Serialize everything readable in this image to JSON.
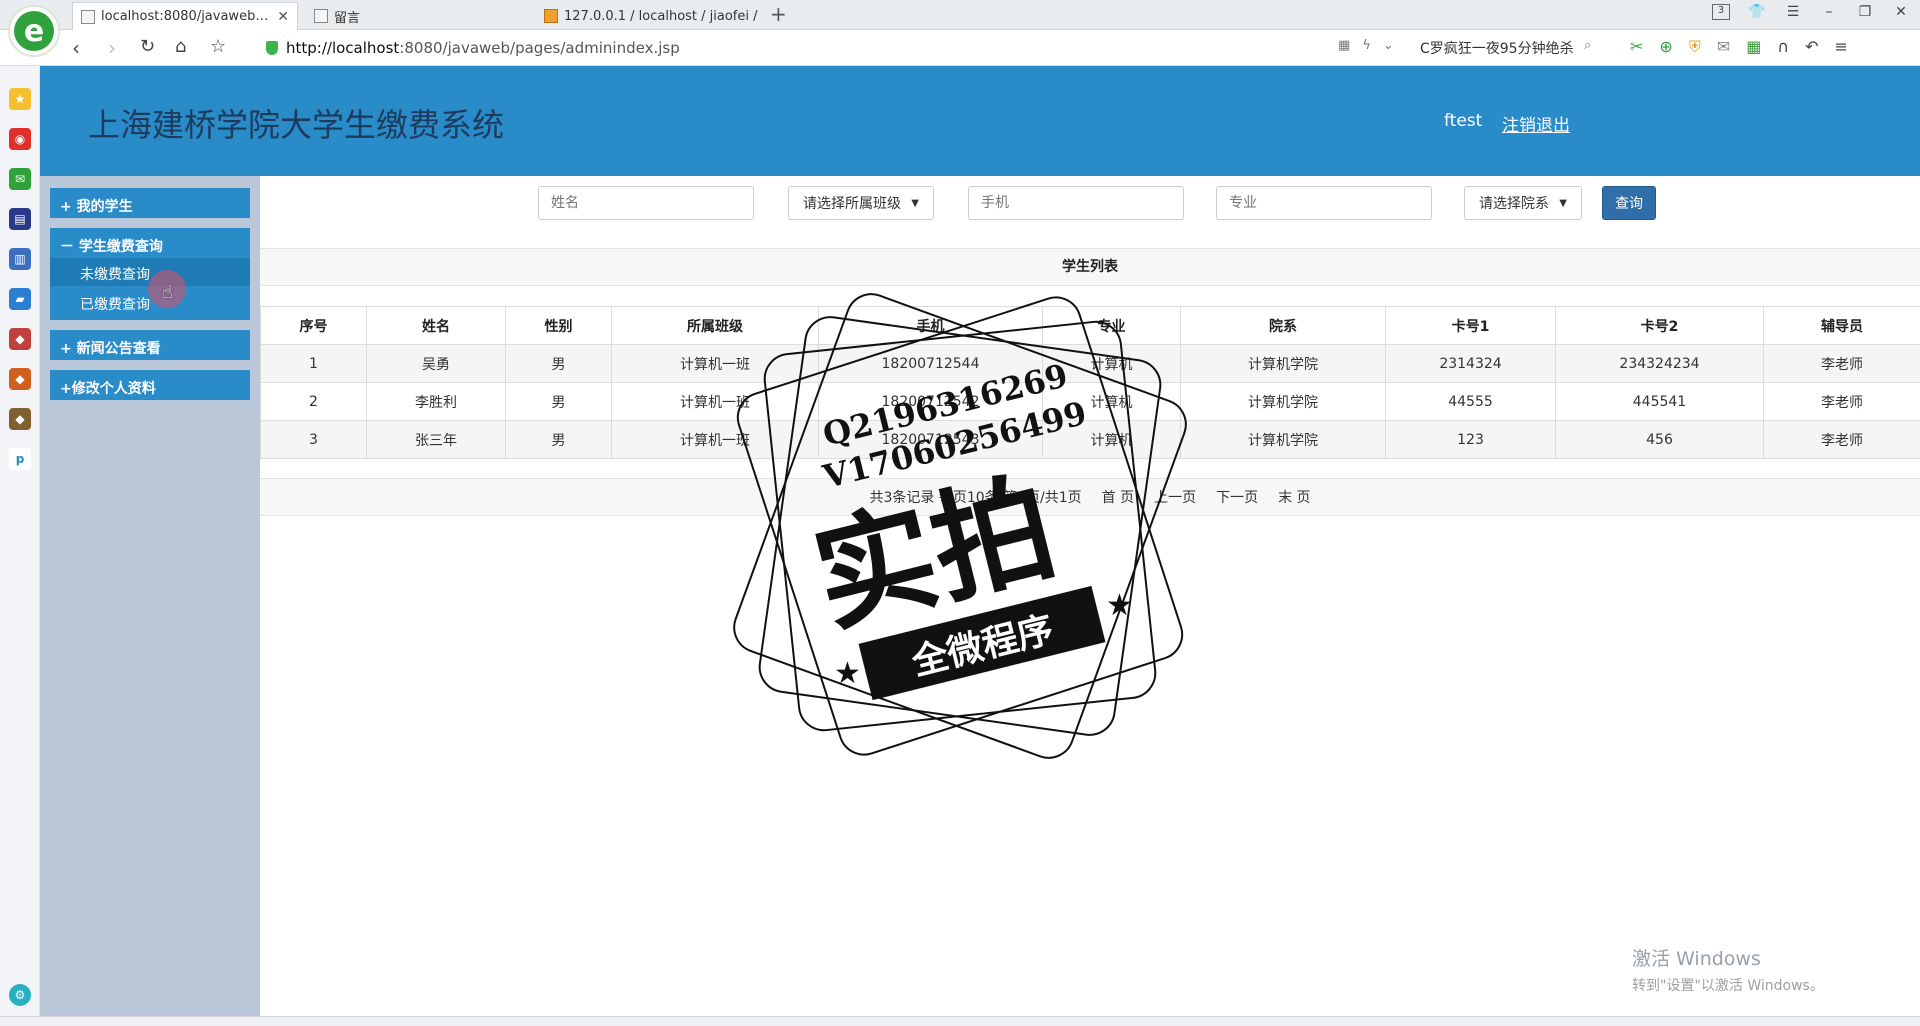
{
  "browser": {
    "tabs": [
      {
        "title": "localhost:8080/javaweb/pages/",
        "active": true
      },
      {
        "title": "留言",
        "active": false
      },
      {
        "title": "127.0.0.1 / localhost / jiaofei /",
        "active": false
      }
    ],
    "new_tab": "+",
    "tab_count": "3",
    "url_host": "http://localhost",
    "url_rest": ":8080/javaweb/pages/adminindex.jsp",
    "search_hint": "C罗疯狂一夜95分钟绝杀"
  },
  "app": {
    "title": "上海建桥学院大学生缴费系统",
    "user": "ftest",
    "logout": "注销退出",
    "accent": "#2a8bc9"
  },
  "sidebar": {
    "my_students": "+ 我的学生",
    "fee_query": "－ 学生缴费查询",
    "unpaid": "未缴费查询",
    "paid": "已缴费查询",
    "news": "+ 新闻公告查看",
    "profile": "+修改个人资料"
  },
  "search": {
    "name_placeholder": "姓名",
    "class_select": "请选择所属班级",
    "phone_placeholder": "手机",
    "major_placeholder": "专业",
    "dept_select": "请选择院系",
    "query": "查询"
  },
  "list": {
    "title": "学生列表",
    "headers": [
      "序号",
      "姓名",
      "性别",
      "所属班级",
      "手机",
      "专业",
      "院系",
      "卡号1",
      "卡号2",
      "辅导员"
    ],
    "rows": [
      [
        "1",
        "吴勇",
        "男",
        "计算机一班",
        "18200712544",
        "计算机",
        "计算机学院",
        "2314324",
        "234324234",
        "李老师"
      ],
      [
        "2",
        "李胜利",
        "男",
        "计算机一班",
        "18200712542",
        "计算机",
        "计算机学院",
        "44555",
        "445541",
        "李老师"
      ],
      [
        "3",
        "张三年",
        "男",
        "计算机一班",
        "18200712543",
        "计算机",
        "计算机学院",
        "123",
        "456",
        "李老师"
      ]
    ]
  },
  "pager": {
    "summary": "共3条记录 每页10条 第1页/共1页",
    "first": "首 页",
    "prev": "上一页",
    "next": "下一页",
    "last": "末 页"
  },
  "watermark": {
    "line1": "Q2196316269",
    "line2": "V17060256499",
    "big": "实拍",
    "banner": "全微程序"
  },
  "windows": {
    "line1": "激活 Windows",
    "line2": "转到\"设置\"以激活 Windows。"
  }
}
